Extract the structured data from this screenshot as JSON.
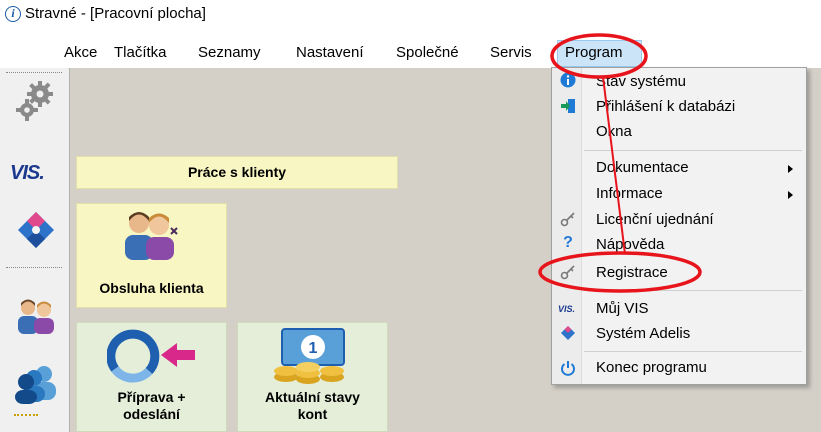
{
  "window": {
    "title": "Stravné - [Pracovní plocha]",
    "app_icon_glyph": "i"
  },
  "menubar": {
    "items": [
      {
        "label": "Akce"
      },
      {
        "label": "Tlačítka"
      },
      {
        "label": "Seznamy"
      },
      {
        "label": "Nastavení"
      },
      {
        "label": "Společné"
      },
      {
        "label": "Servis"
      },
      {
        "label": "Program",
        "active": true
      }
    ]
  },
  "sidebar": {
    "icons": [
      "gears-icon",
      "vis-logo-icon",
      "adelis-puzzle-icon",
      "clients-icon",
      "people-icon",
      "ruler-icon"
    ],
    "vis_logo_text": "VIS."
  },
  "workspace": {
    "panel_title": "Práce s klienty",
    "tiles": [
      {
        "label_lines": [
          "Obsluha klienta"
        ]
      },
      {
        "label_lines": [
          "Příprava +",
          "odeslání"
        ]
      },
      {
        "label_lines": [
          "Aktuální stavy",
          "kont"
        ]
      }
    ]
  },
  "program_menu": {
    "items": [
      {
        "label": "Stav systému",
        "icon": "info-icon"
      },
      {
        "label": "Přihlášení k databázi",
        "icon": "login-icon"
      },
      {
        "label": "Okna"
      },
      {
        "label": "Dokumentace",
        "submenu": true
      },
      {
        "label": "Informace",
        "submenu": true
      },
      {
        "label": "Licenční ujednání",
        "icon": "key-icon"
      },
      {
        "label": "Nápověda",
        "icon": "help-icon"
      },
      {
        "label": "Registrace",
        "icon": "key-icon"
      },
      {
        "label": "Můj VIS",
        "icon": "vis-small-icon"
      },
      {
        "label": "Systém Adelis",
        "icon": "adelis-small-icon"
      },
      {
        "label": "Konec programu",
        "icon": "power-icon"
      }
    ],
    "vis_small_text": "VIS."
  },
  "colors": {
    "annotation_red": "#e8141c",
    "menu_highlight": "#cce4f7",
    "tile_yellow": "#f8f6c3",
    "tile_green": "#e4eed8",
    "workspace_gray": "#d4d0c8"
  }
}
